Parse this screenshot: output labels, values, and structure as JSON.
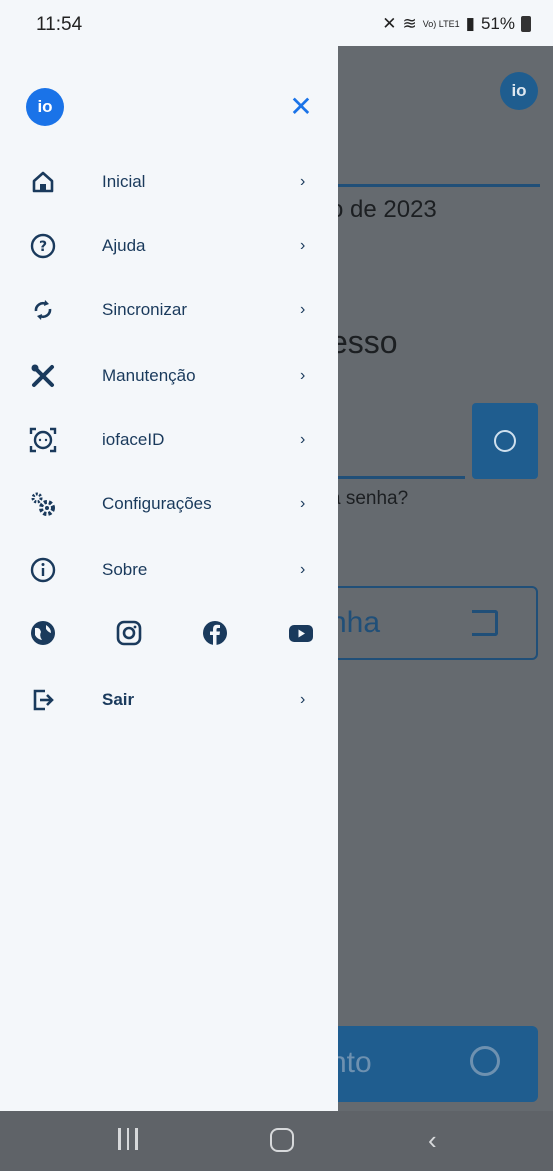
{
  "status_bar": {
    "time": "11:54",
    "battery": "51%",
    "network": "Vo) LTE1"
  },
  "background_app": {
    "logo": "io",
    "date_text": "o de 2023",
    "title": "esso",
    "forgot_password": "a senha?",
    "password_button": "nha",
    "face_button": "nto"
  },
  "drawer": {
    "logo": "io",
    "close_icon": "close-icon",
    "items": [
      {
        "label": "Inicial",
        "icon": "home-icon"
      },
      {
        "label": "Ajuda",
        "icon": "help-icon"
      },
      {
        "label": "Sincronizar",
        "icon": "sync-icon"
      },
      {
        "label": "Manutenção",
        "icon": "tools-icon"
      },
      {
        "label": "iofaceID",
        "icon": "face-id-icon"
      },
      {
        "label": "Configurações",
        "icon": "gear-icon"
      },
      {
        "label": "Sobre",
        "icon": "info-icon"
      }
    ],
    "social": [
      "globe-icon",
      "instagram-icon",
      "facebook-icon",
      "youtube-icon"
    ],
    "logout": {
      "label": "Sair",
      "icon": "logout-icon"
    },
    "chevron": "›"
  },
  "colors": {
    "accent": "#1a73e8",
    "navy": "#1a3a5c",
    "drawer_bg": "#f4f7fa"
  }
}
